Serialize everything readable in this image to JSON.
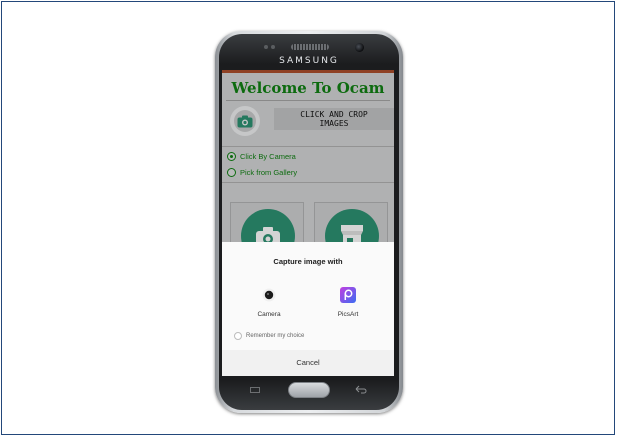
{
  "device": {
    "brand": "SAMSUNG"
  },
  "app": {
    "title": "Welcome To Ocam",
    "crop_label_line1": "CLICK AND CROP",
    "crop_label_line2": "IMAGES",
    "options": [
      {
        "label": "Click By Camera",
        "checked": true
      },
      {
        "label": "Pick from Gallery",
        "checked": false
      }
    ],
    "accent_color": "#0f7a12",
    "tile_color": "#2b8a6d"
  },
  "chooser": {
    "title": "Capture image with",
    "apps": [
      {
        "label": "Camera",
        "icon": "camera-app-icon"
      },
      {
        "label": "PicsArt",
        "icon": "picsart-app-icon"
      }
    ],
    "remember_label": "Remember my choice",
    "cancel_label": "Cancel"
  }
}
